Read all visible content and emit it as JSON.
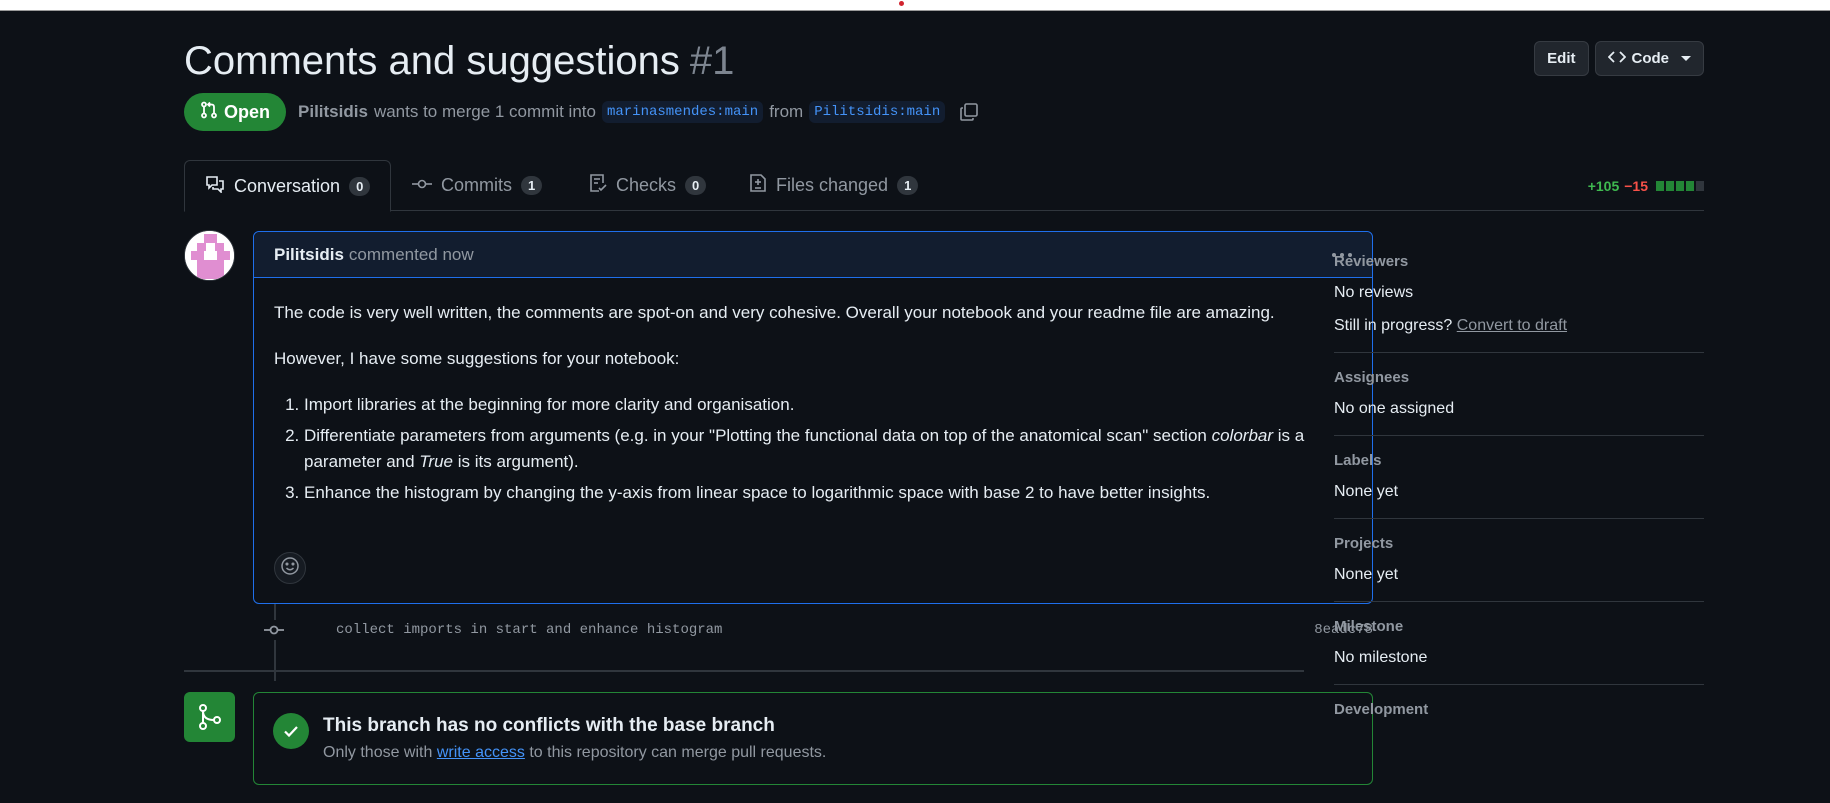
{
  "pr": {
    "title": "Comments and suggestions",
    "number": "#1",
    "state": "Open",
    "author": "Pilitsidis",
    "merge_text": "wants to merge 1 commit into",
    "base_branch": "marinasmendes:main",
    "from_text": "from",
    "head_branch": "Pilitsidis:main"
  },
  "header_actions": {
    "edit_label": "Edit",
    "code_label": "Code"
  },
  "tabs": [
    {
      "label": "Conversation",
      "count": "0"
    },
    {
      "label": "Commits",
      "count": "1"
    },
    {
      "label": "Checks",
      "count": "0"
    },
    {
      "label": "Files changed",
      "count": "1"
    }
  ],
  "diffstat": {
    "additions": "+105",
    "deletions": "−15",
    "blocks_added": 4,
    "blocks_total": 5
  },
  "comment": {
    "author": "Pilitsidis",
    "time_text": "commented now",
    "para1": "The code is very well written, the comments are spot-on and very cohesive. Overall your notebook and your readme file are amazing.",
    "para2": "However, I have some suggestions for your notebook:",
    "item1": "Import libraries at the beginning for more clarity and organisation.",
    "item2_a": "Differentiate parameters from arguments (e.g. in your \"Plotting the functional data on top of the anatomical scan\" section ",
    "item2_em1": "colorbar",
    "item2_b": " is a parameter and ",
    "item2_em2": "True",
    "item2_c": " is its argument).",
    "item3": "Enhance the histogram by changing the y-axis from linear space to logarithmic space with base 2 to have better insights."
  },
  "commit": {
    "message": "collect imports in start and enhance histogram",
    "sha": "8eadc78"
  },
  "merge": {
    "title": "This branch has no conflicts with the base branch",
    "sub_before": "Only those with",
    "sub_link": "write access",
    "sub_after": "to this repository can merge pull requests."
  },
  "sidebar": {
    "reviewers": {
      "heading": "Reviewers",
      "value": "No reviews",
      "draft_prefix": "Still in progress?",
      "draft_link": "Convert to draft"
    },
    "assignees": {
      "heading": "Assignees",
      "value": "No one assigned"
    },
    "labels": {
      "heading": "Labels",
      "value": "None yet"
    },
    "projects": {
      "heading": "Projects",
      "value": "None yet"
    },
    "milestone": {
      "heading": "Milestone",
      "value": "No milestone"
    },
    "development": {
      "heading": "Development"
    }
  },
  "colors": {
    "accent": "#238636",
    "link": "#4493f8",
    "background": "#0d1117"
  },
  "icons": [
    "git-pull-request-icon",
    "copy-icon",
    "code-icon",
    "comment-discussion-icon",
    "git-commit-icon",
    "checklist-icon",
    "file-diff-icon",
    "kebab-horizontal-icon",
    "smiley-icon",
    "git-merge-icon",
    "check-icon"
  ]
}
